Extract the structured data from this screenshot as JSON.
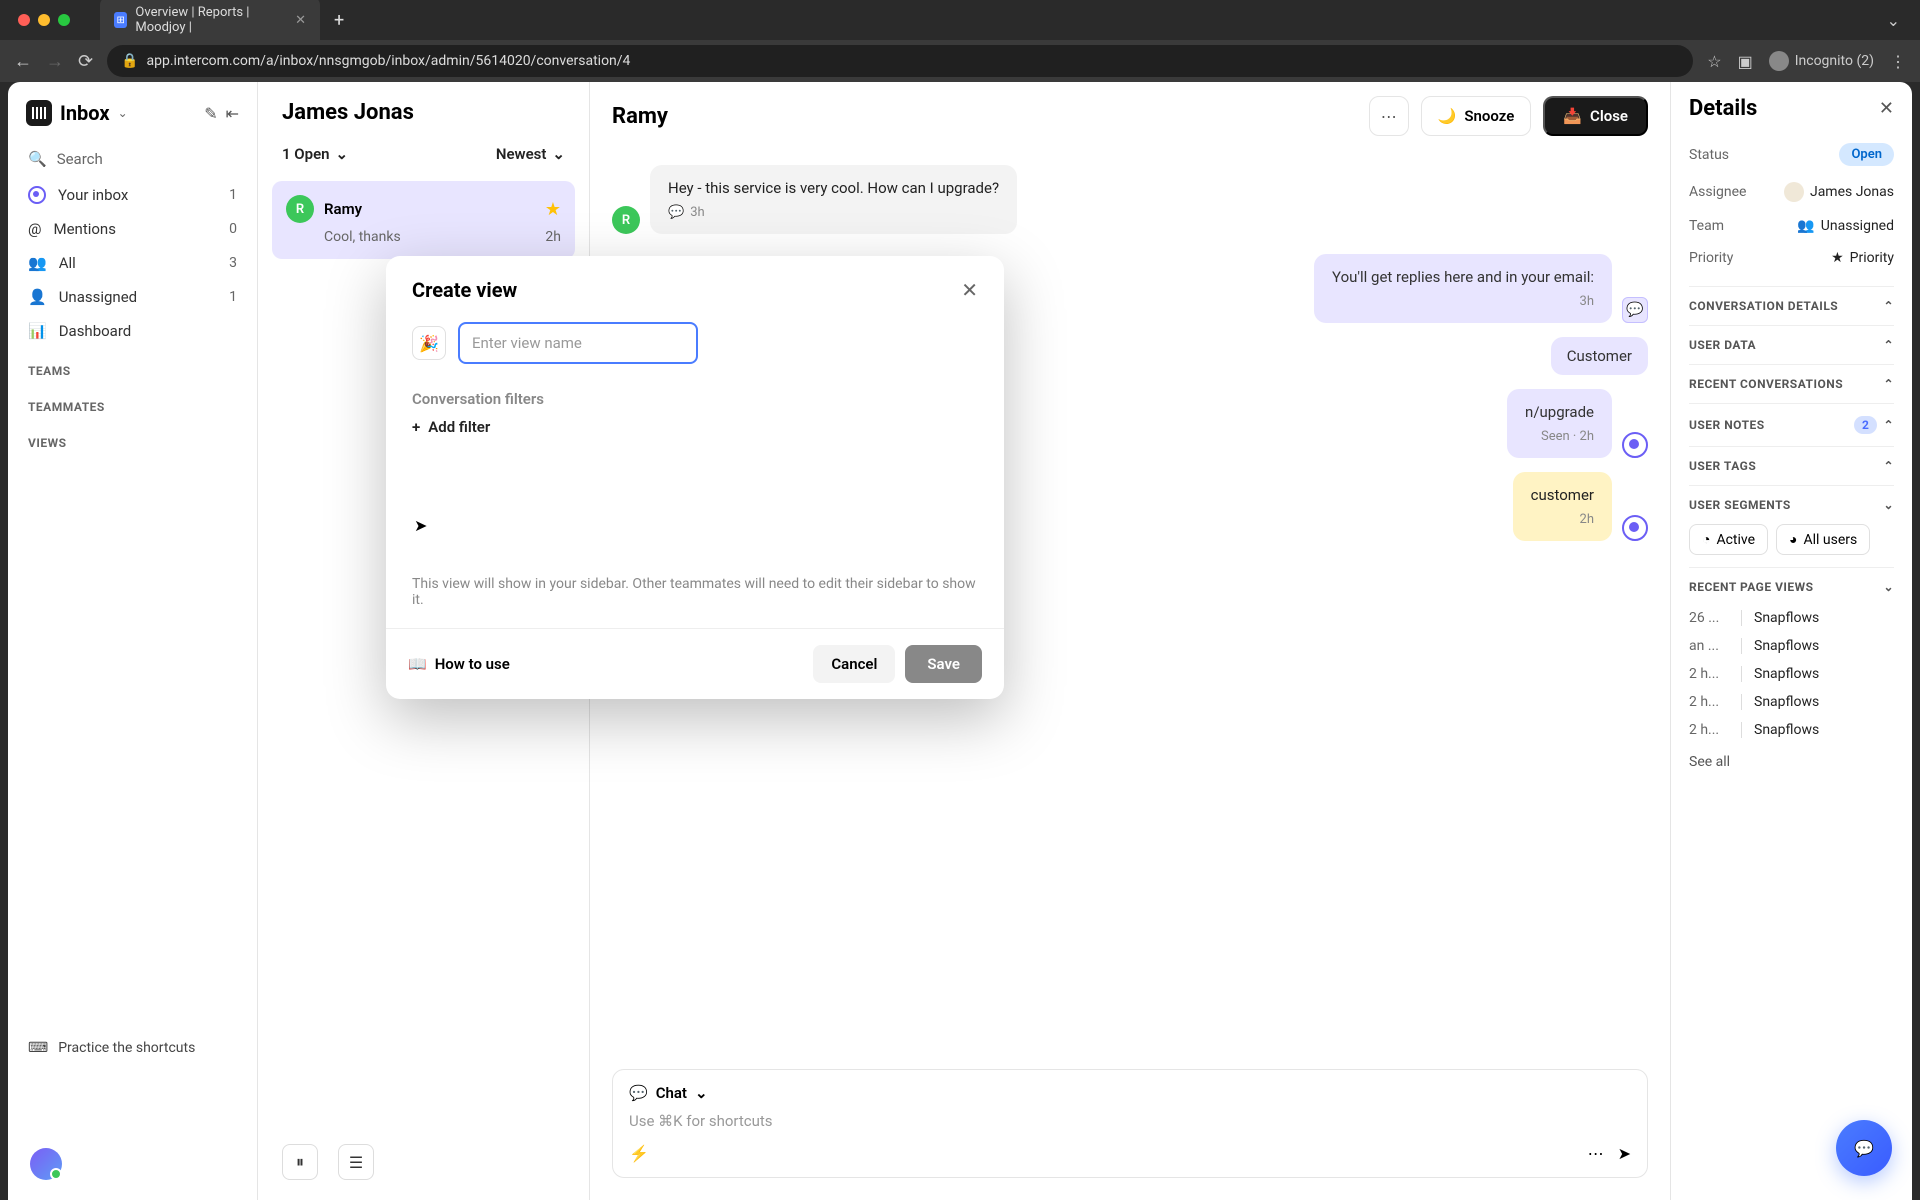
{
  "browser": {
    "tab_title": "Overview | Reports | Moodjoy |",
    "url": "app.intercom.com/a/inbox/nnsgmgob/inbox/admin/5614020/conversation/4",
    "incognito_label": "Incognito (2)"
  },
  "sidebar": {
    "title": "Inbox",
    "search_label": "Search",
    "items": [
      {
        "label": "Your inbox",
        "count": "1"
      },
      {
        "label": "Mentions",
        "count": "0"
      },
      {
        "label": "All",
        "count": "3"
      },
      {
        "label": "Unassigned",
        "count": "1"
      },
      {
        "label": "Dashboard",
        "count": ""
      }
    ],
    "sections": {
      "teams": "TEAMS",
      "teammates": "TEAMMATES",
      "views": "VIEWS"
    },
    "shortcuts": "Practice the shortcuts"
  },
  "conv_list": {
    "title": "James Jonas",
    "open_filter": "1 Open",
    "sort": "Newest",
    "item": {
      "avatar": "R",
      "name": "Ramy",
      "preview": "Cool, thanks",
      "time": "2h"
    }
  },
  "conversation": {
    "title": "Ramy",
    "snooze": "Snooze",
    "close": "Close",
    "messages": {
      "incoming": {
        "text": "Hey - this service is very cool. How can I upgrade?",
        "time": "3h",
        "avatar": "R"
      },
      "reply1": {
        "text": "You'll get replies here and in your email:",
        "time": "3h"
      },
      "reply2": {
        "text": "Customer"
      },
      "reply3": {
        "text": "n/upgrade",
        "meta": "Seen · 2h"
      },
      "note": {
        "text": "customer",
        "time": "2h"
      }
    },
    "composer": {
      "mode": "Chat",
      "placeholder": "Use ⌘K for shortcuts"
    }
  },
  "details": {
    "title": "Details",
    "rows": {
      "status": {
        "label": "Status",
        "value": "Open"
      },
      "assignee": {
        "label": "Assignee",
        "value": "James Jonas"
      },
      "team": {
        "label": "Team",
        "value": "Unassigned"
      },
      "priority": {
        "label": "Priority",
        "value": "Priority"
      }
    },
    "sections": {
      "conv_details": "CONVERSATION DETAILS",
      "user_data": "USER DATA",
      "recent_conv": "RECENT CONVERSATIONS",
      "user_notes": "USER NOTES",
      "user_notes_count": "2",
      "user_tags": "USER TAGS",
      "user_segments": "USER SEGMENTS",
      "recent_pages": "RECENT PAGE VIEWS"
    },
    "segments": [
      "Active",
      "All users"
    ],
    "page_views": [
      {
        "time": "26 ...",
        "name": "Snapflows"
      },
      {
        "time": "an ...",
        "name": "Snapflows"
      },
      {
        "time": "2 h...",
        "name": "Snapflows"
      },
      {
        "time": "2 h...",
        "name": "Snapflows"
      },
      {
        "time": "2 h...",
        "name": "Snapflows"
      }
    ],
    "see_all": "See all"
  },
  "modal": {
    "title": "Create view",
    "input_placeholder": "Enter view name",
    "filters_label": "Conversation filters",
    "add_filter": "Add filter",
    "help_text": "This view will show in your sidebar. Other teammates will need to edit their sidebar to show it.",
    "how_to": "How to use",
    "cancel": "Cancel",
    "save": "Save",
    "emoji": "🎉"
  }
}
